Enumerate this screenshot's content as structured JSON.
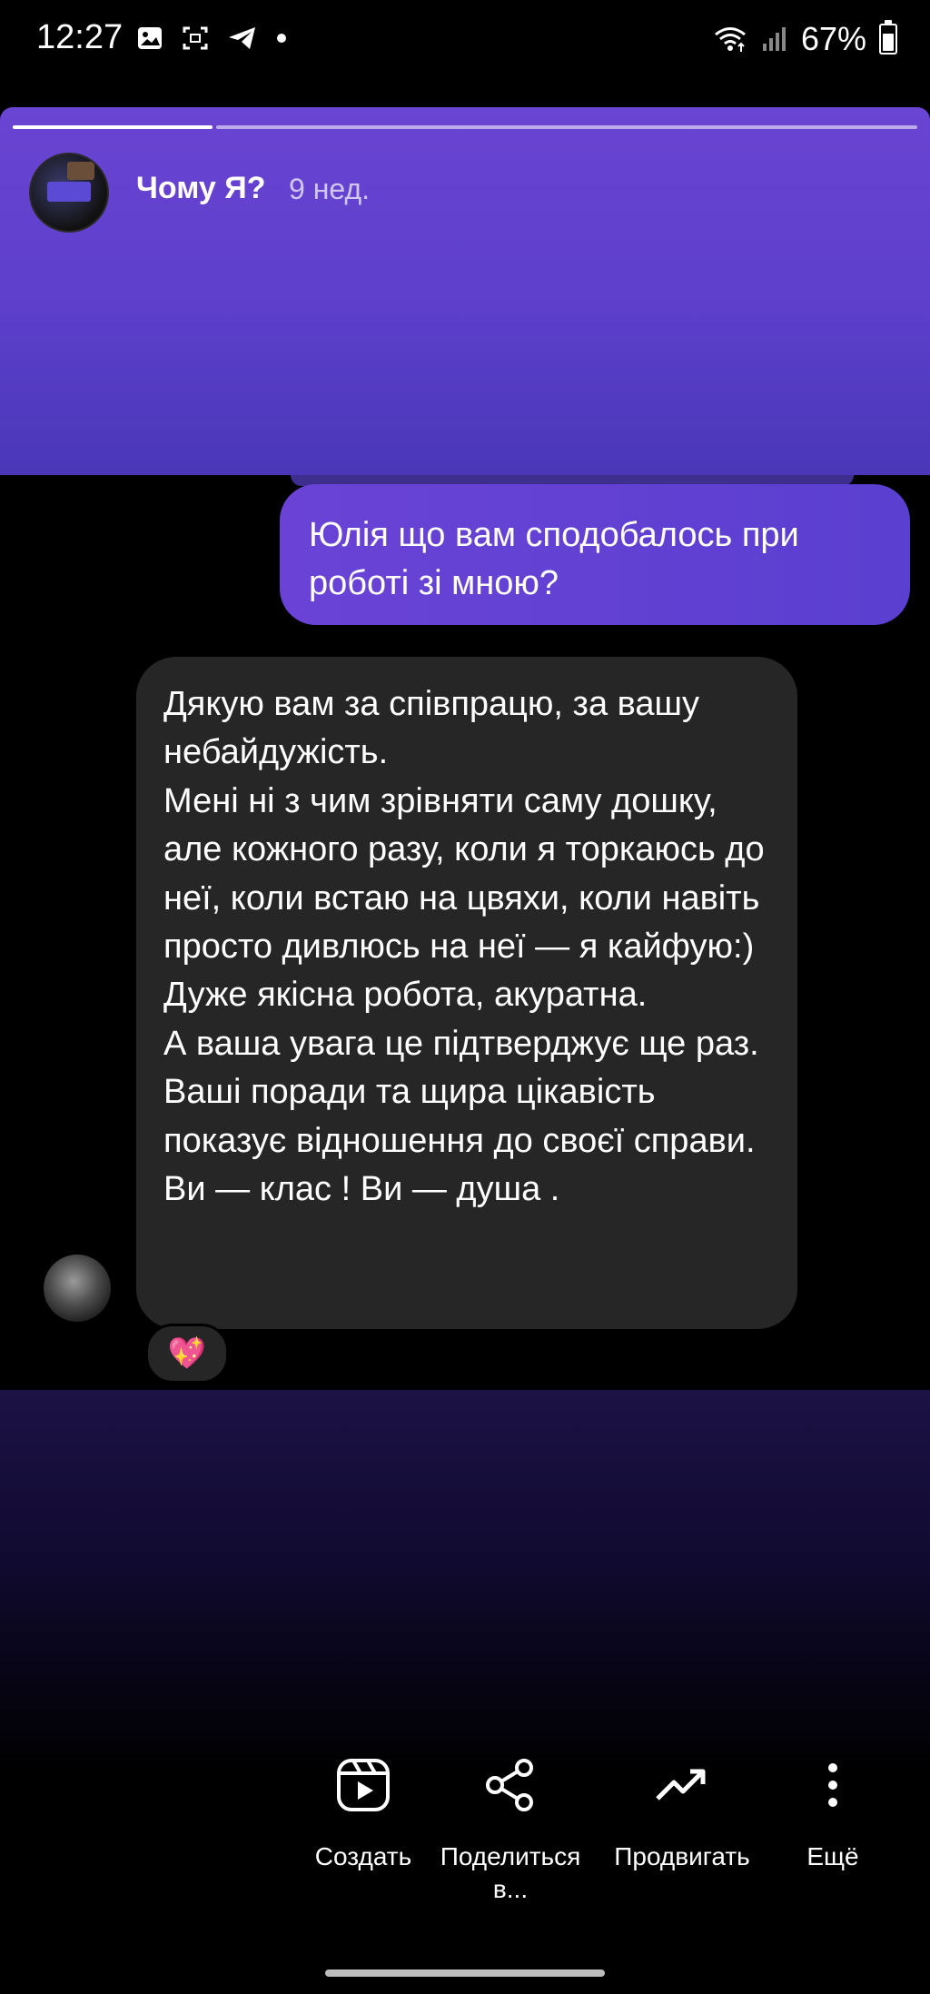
{
  "status_bar": {
    "time": "12:27",
    "battery_percent": "67%",
    "icons_left": [
      "image-icon",
      "screenshot-icon",
      "telegram-icon",
      "dot-icon"
    ],
    "icons_right": [
      "wifi-icon",
      "signal-icon",
      "battery-icon"
    ]
  },
  "story": {
    "progress_segments": 2,
    "progress_current": 1,
    "author": "Чому Я?",
    "time_ago": "9 нед.",
    "accent_color": "#6a44d2"
  },
  "chat": {
    "sent_message": "Юлія що вам сподобалось при роботі зі мною?",
    "received_message": "Дякую вам за співпрацю, за вашу небайдужість.\nМені ні з чим зрівняти саму дошку, але кожного разу, коли я торкаюсь до неї, коли встаю на цвяхи, коли навіть просто дивлюсь на неї — я кайфую:)\nДуже якісна робота, акуратна.\nА ваша увага це підтверджує ще раз. Ваші поради та щира цікавість показує відношення до своєї справи. Ви — клас ! Ви — душа .",
    "reaction": "💖"
  },
  "actions": [
    {
      "label": "Создать",
      "icon": "reels-icon"
    },
    {
      "label": "Поделиться в...",
      "icon": "share-icon"
    },
    {
      "label": "Продвигать",
      "icon": "trending-icon"
    },
    {
      "label": "Ещё",
      "icon": "more-icon"
    }
  ]
}
